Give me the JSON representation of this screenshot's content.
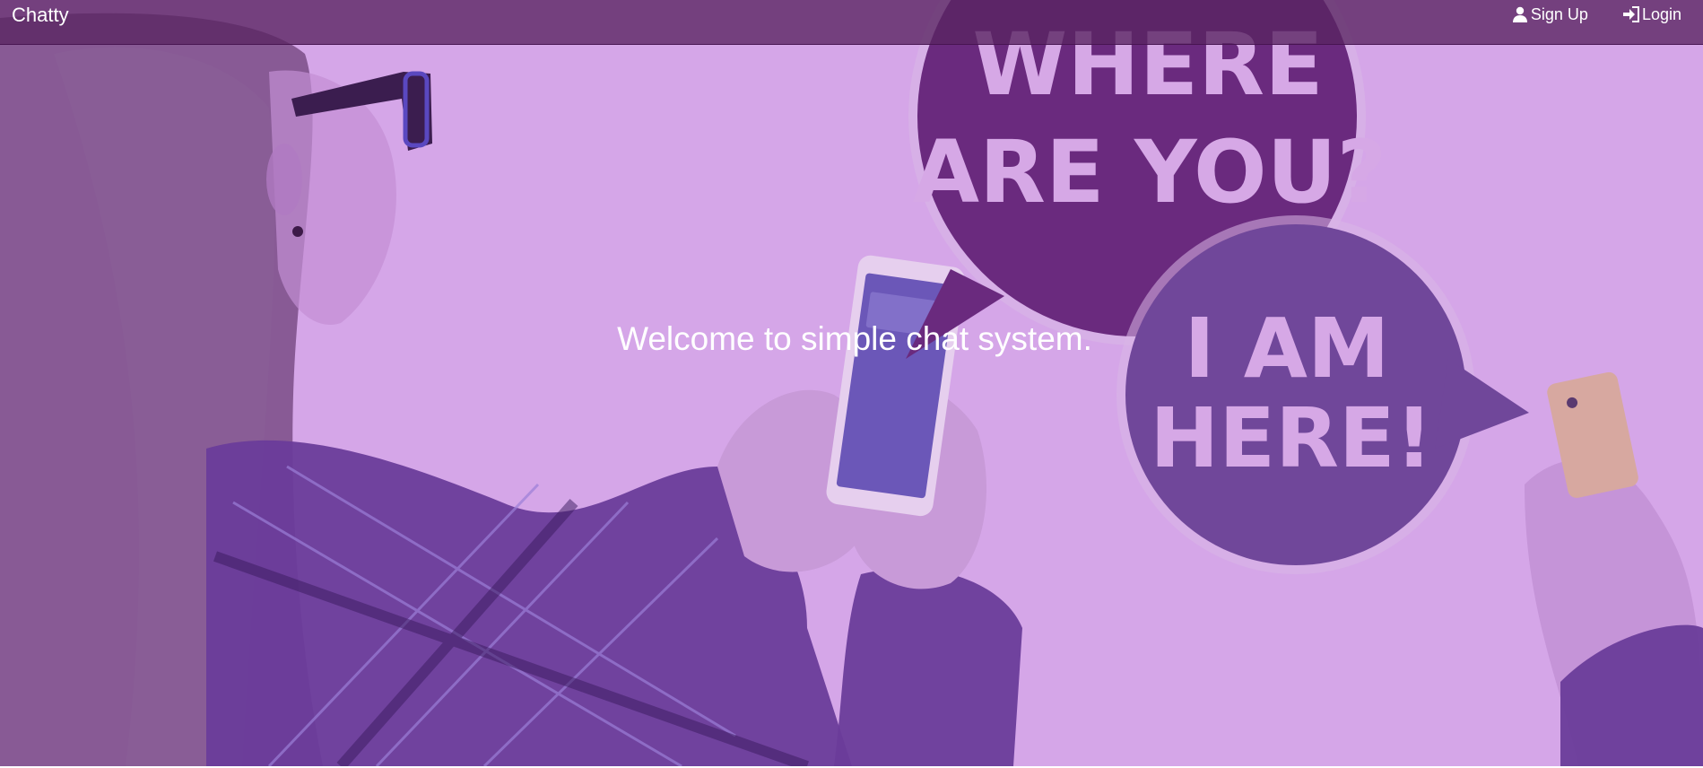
{
  "navbar": {
    "brand": "Chatty",
    "signup_label": "Sign Up",
    "login_label": "Login",
    "background_color": "#5a2462"
  },
  "hero": {
    "headline": "Welcome to simple chat system.",
    "bubble_top_text_line1": "WHERE",
    "bubble_top_text_line2": "ARE YOU?",
    "bubble_bottom_text_line1": "I AM",
    "bubble_bottom_text_line2": "HERE!",
    "overlay_color": "#d5a6e8"
  },
  "icons": {
    "signup": "user-icon",
    "login": "sign-in-icon"
  }
}
